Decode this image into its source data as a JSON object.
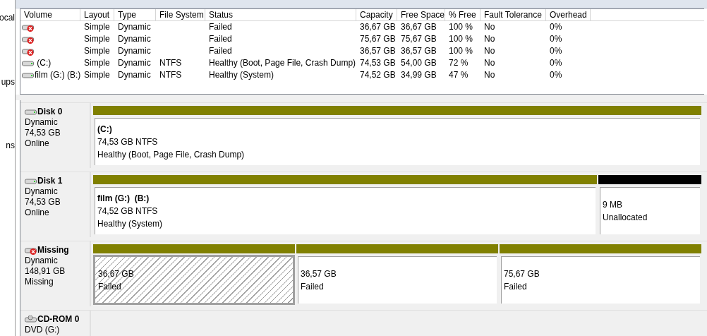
{
  "sidebar": {
    "items": [
      {
        "label": "ocal"
      },
      {
        "label": "ups"
      },
      {
        "label": "ns"
      }
    ]
  },
  "table": {
    "columns": [
      "Volume",
      "Layout",
      "Type",
      "File System",
      "Status",
      "Capacity",
      "Free Space",
      "% Free",
      "Fault Tolerance",
      "Overhead"
    ],
    "rows": [
      {
        "kind": "failed",
        "cells": [
          "",
          "Simple",
          "Dynamic",
          "",
          "Failed",
          "36,67 GB",
          "36,67 GB",
          "100 %",
          "No",
          "0%"
        ]
      },
      {
        "kind": "failed",
        "cells": [
          "",
          "Simple",
          "Dynamic",
          "",
          "Failed",
          "75,67 GB",
          "75,67 GB",
          "100 %",
          "No",
          "0%"
        ]
      },
      {
        "kind": "failed",
        "cells": [
          "",
          "Simple",
          "Dynamic",
          "",
          "Failed",
          "36,57 GB",
          "36,57 GB",
          "100 %",
          "No",
          "0%"
        ]
      },
      {
        "kind": "healthy",
        "cells": [
          " (C:)",
          "Simple",
          "Dynamic",
          "NTFS",
          "Healthy (Boot, Page File, Crash Dump)",
          "74,53 GB",
          "54,00 GB",
          "72 %",
          "No",
          "0%"
        ]
      },
      {
        "kind": "healthy",
        "cells": [
          "film (G:) (B:)",
          "Simple",
          "Dynamic",
          "NTFS",
          "Healthy (System)",
          "74,52 GB",
          "34,99 GB",
          "47 %",
          "No",
          "0%"
        ]
      }
    ]
  },
  "disks": [
    {
      "kind": "online",
      "name": "Disk 0",
      "lines": [
        "Dynamic",
        "74,53 GB",
        "Online"
      ],
      "partitions": [
        {
          "kind": "volume",
          "selected": false,
          "title": "(C:)",
          "lines": [
            "74,53 GB NTFS",
            "Healthy (Boot, Page File, Crash Dump)"
          ]
        }
      ]
    },
    {
      "kind": "online",
      "name": "Disk 1",
      "lines": [
        "Dynamic",
        "74,53 GB",
        "Online"
      ],
      "partitions": [
        {
          "kind": "volume",
          "selected": false,
          "title": "film (G:)  (B:)",
          "lines": [
            "74,52 GB NTFS",
            "Healthy (System)"
          ]
        },
        {
          "kind": "unallocated",
          "selected": false,
          "lines": [
            "9 MB",
            "Unallocated"
          ]
        }
      ]
    },
    {
      "kind": "missing",
      "name": "Missing",
      "lines": [
        "Dynamic",
        "148,91 GB",
        "Missing"
      ],
      "partitions": [
        {
          "kind": "volume",
          "selected": true,
          "lines": [
            "36,67 GB",
            "Failed"
          ]
        },
        {
          "kind": "volume",
          "selected": false,
          "lines": [
            "36,57 GB",
            "Failed"
          ]
        },
        {
          "kind": "volume",
          "selected": false,
          "lines": [
            "75,67 GB",
            "Failed"
          ]
        }
      ]
    },
    {
      "kind": "cdrom",
      "name": "CD-ROM 0",
      "lines": [
        "DVD (G:)"
      ]
    }
  ]
}
